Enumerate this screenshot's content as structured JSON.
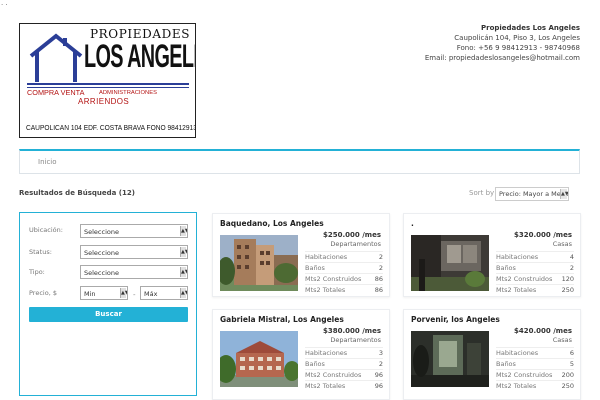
{
  "corner_dots": ". .",
  "logo": {
    "top": "PROPIEDADES",
    "big": "LOS ANGELES",
    "compra_venta": "COMPRA VENTA",
    "administraciones": "ADMINISTRACIONES",
    "arriendos": "ARRIENDOS",
    "address": "CAUPOLICAN 104 EDF. COSTA BRAVA FONO 98412913",
    "colors": {
      "house": "#2b3e97",
      "accent": "#b41414"
    }
  },
  "contact": {
    "name": "Propiedades Los Angeles",
    "address": "Caupolicán 104, Piso 3, Los Angeles",
    "phone": "Fono: +56 9 98412913 - 98740968",
    "email": "Email: propiedadeslosangeles@hotmail.com"
  },
  "breadcrumb": {
    "home": "Inicio"
  },
  "results": {
    "label": "Resultados de Búsqueda (12)"
  },
  "sort": {
    "label": "Sort by",
    "selected": "Precio: Mayor a Menor"
  },
  "search": {
    "ubicacion_label": "Ubicación:",
    "ubicacion_value": "Seleccione",
    "status_label": "Status:",
    "status_value": "Seleccione",
    "tipo_label": "Tipo:",
    "tipo_value": "Seleccione",
    "precio_label": "Precio, $",
    "min_value": "Min",
    "dash": "-",
    "max_value": "Máx",
    "button_label": "Buscar"
  },
  "accent_color": "#23b1d6",
  "properties": [
    {
      "title": "Baquedano, Los Angeles",
      "price": "$250.000 /mes",
      "type": "Departamentos",
      "rows": [
        {
          "label": "Habitaciones",
          "value": "2"
        },
        {
          "label": "Baños",
          "value": "2"
        },
        {
          "label": "Mts2 Construidos",
          "value": "86"
        },
        {
          "label": "Mts2 Totales",
          "value": "86"
        }
      ]
    },
    {
      "title": ".",
      "price": "$320.000 /mes",
      "type": "Casas",
      "rows": [
        {
          "label": "Habitaciones",
          "value": "4"
        },
        {
          "label": "Baños",
          "value": "2"
        },
        {
          "label": "Mts2 Construidos",
          "value": "120"
        },
        {
          "label": "Mts2 Totales",
          "value": "250"
        }
      ]
    },
    {
      "title": "Gabriela Mistral, Los Angeles",
      "price": "$380.000 /mes",
      "type": "Departamentos",
      "rows": [
        {
          "label": "Habitaciones",
          "value": "3"
        },
        {
          "label": "Baños",
          "value": "2"
        },
        {
          "label": "Mts2 Construidos",
          "value": "96"
        },
        {
          "label": "Mts2 Totales",
          "value": "96"
        }
      ]
    },
    {
      "title": "Porvenir, los Angeles",
      "price": "$420.000 /mes",
      "type": "Casas",
      "rows": [
        {
          "label": "Habitaciones",
          "value": "6"
        },
        {
          "label": "Baños",
          "value": "5"
        },
        {
          "label": "Mts2 Construidos",
          "value": "200"
        },
        {
          "label": "Mts2 Totales",
          "value": "250"
        }
      ]
    }
  ]
}
